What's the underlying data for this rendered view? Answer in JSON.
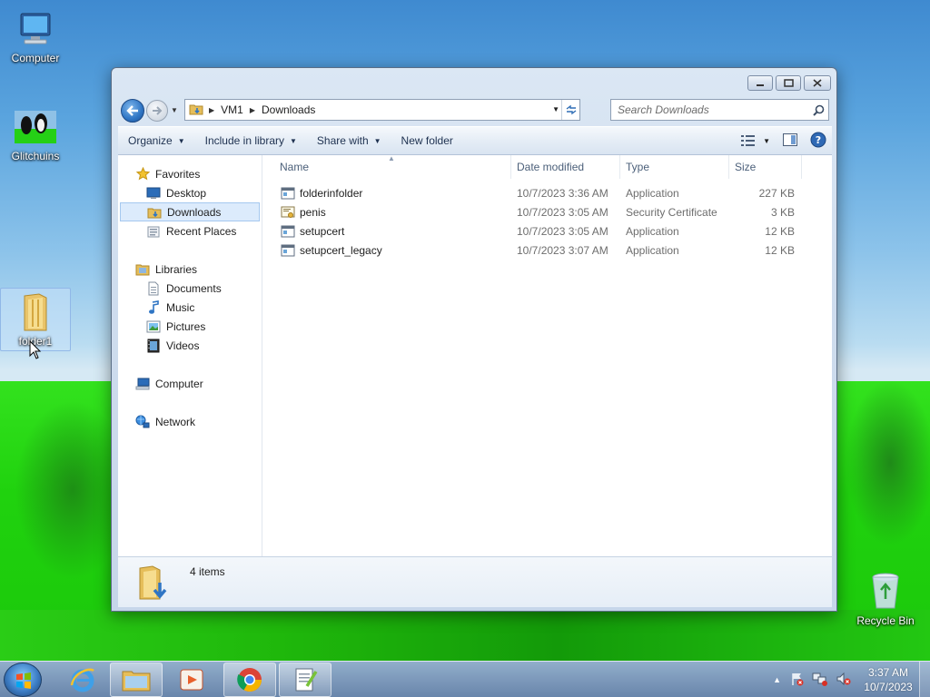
{
  "desktop": {
    "icons": [
      {
        "label": "Computer"
      },
      {
        "label": "Glitchuins"
      },
      {
        "label": "folder1"
      },
      {
        "label": "Recycle Bin"
      }
    ]
  },
  "window": {
    "breadcrumb": [
      "VM1",
      "Downloads"
    ],
    "search_placeholder": "Search Downloads",
    "toolbar": {
      "organize": "Organize",
      "include_in_library": "Include in library",
      "share_with": "Share with",
      "new_folder": "New folder"
    },
    "nav": {
      "favorites": "Favorites",
      "desktop": "Desktop",
      "downloads": "Downloads",
      "recent_places": "Recent Places",
      "libraries": "Libraries",
      "documents": "Documents",
      "music": "Music",
      "pictures": "Pictures",
      "videos": "Videos",
      "computer": "Computer",
      "network": "Network"
    },
    "columns": {
      "name": "Name",
      "date_modified": "Date modified",
      "type": "Type",
      "size": "Size"
    },
    "files": [
      {
        "name": "folderinfolder",
        "date": "10/7/2023 3:36 AM",
        "type": "Application",
        "size": "227 KB"
      },
      {
        "name": "penis",
        "date": "10/7/2023 3:05 AM",
        "type": "Security Certificate",
        "size": "3 KB"
      },
      {
        "name": "setupcert",
        "date": "10/7/2023 3:05 AM",
        "type": "Application",
        "size": "12 KB"
      },
      {
        "name": "setupcert_legacy",
        "date": "10/7/2023 3:07 AM",
        "type": "Application",
        "size": "12 KB"
      }
    ],
    "details": {
      "item_count": "4 items"
    }
  },
  "taskbar": {
    "clock_time": "3:37 AM",
    "clock_date": "10/7/2023"
  },
  "colors": {
    "accent": "#2f75c4",
    "wallpaper_green": "#20d20e",
    "selection": "#dcebfc"
  }
}
